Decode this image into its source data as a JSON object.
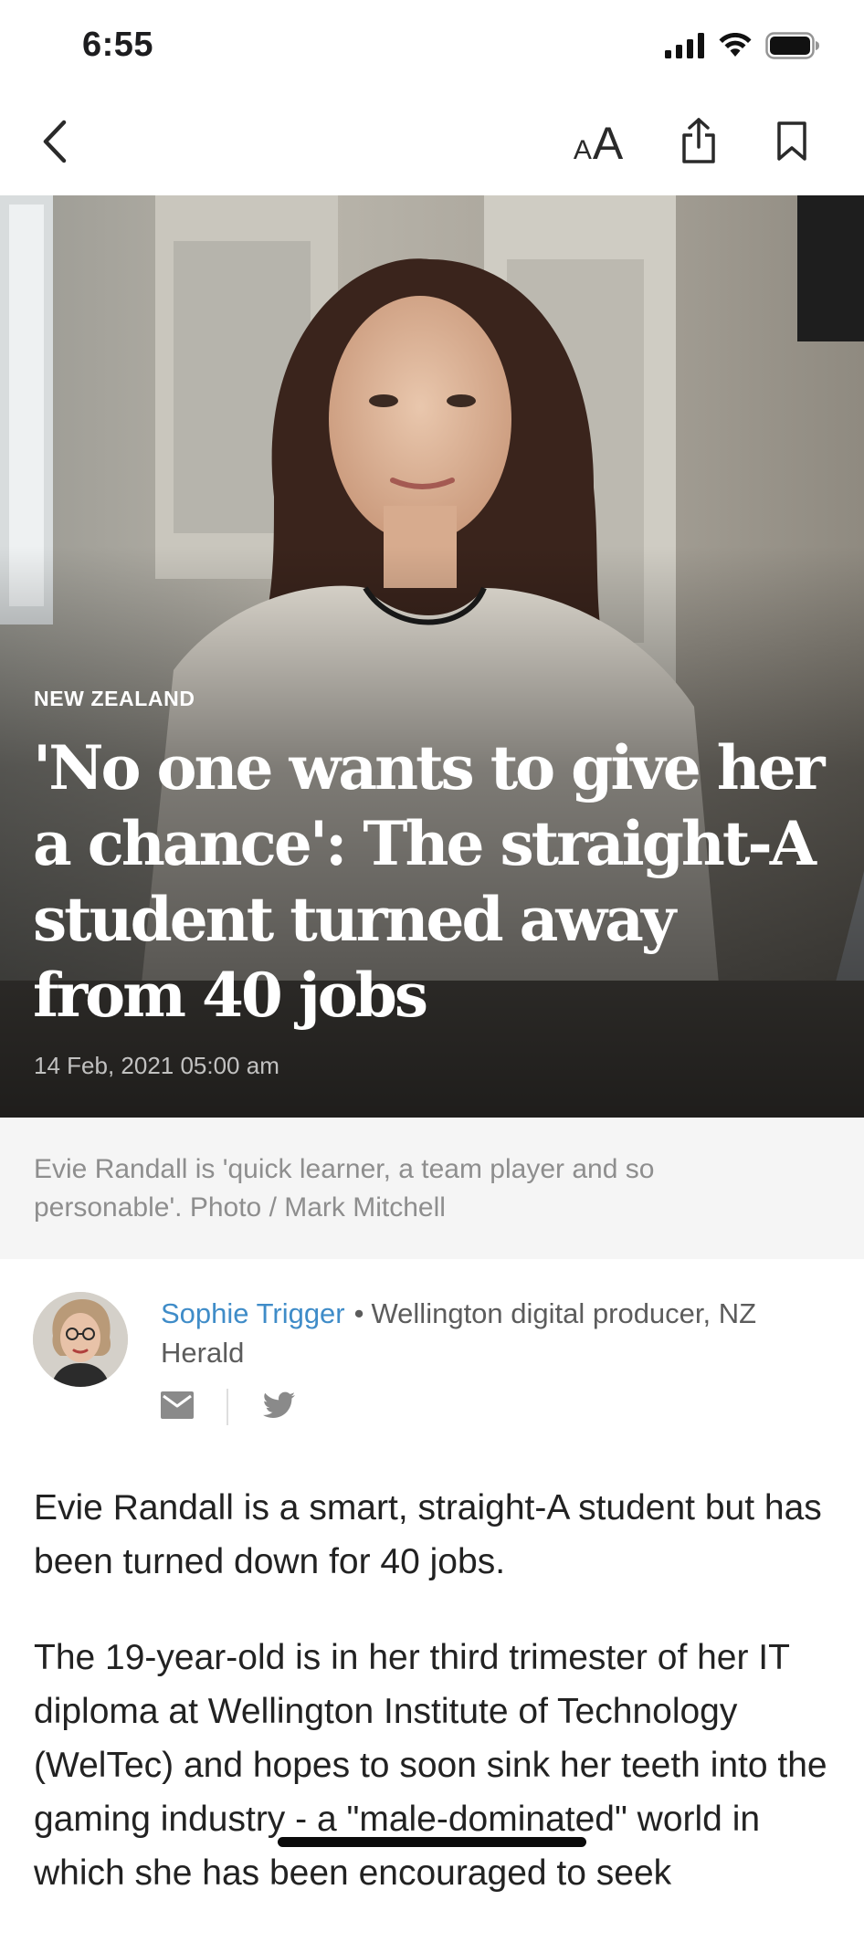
{
  "status_bar": {
    "time": "6:55"
  },
  "nav": {
    "icons": [
      "chevron-left-icon",
      "text-size-icon",
      "share-icon",
      "bookmark-icon"
    ],
    "text_size_small": "A",
    "text_size_large": "A"
  },
  "hero": {
    "section": "NEW ZEALAND",
    "title": "'No one wants to give her a chance': The straight-A student turned away from 40 jobs",
    "date": "14 Feb, 2021 05:00 am"
  },
  "caption": {
    "text": "Evie Randall is 'quick learner, a team player and so personable'. Photo / Mark Mitchell"
  },
  "author": {
    "name": "Sophie Trigger",
    "separator": "•",
    "role": "Wellington digital producer, NZ Herald",
    "icons": [
      "email-icon",
      "twitter-icon"
    ]
  },
  "article": {
    "paragraphs": [
      "Evie Randall is a smart, straight-A student but has been turned down for 40 jobs.",
      "The 19-year-old is in her third trimester of her IT diploma at Wellington Institute of Technology (WelTec) and hopes to soon sink her teeth into the gaming industry - a \"male-dominated\" world in which she has been encouraged to seek"
    ]
  },
  "colors": {
    "accent_link": "#3f8cc8",
    "caption_bg": "#f5f5f5",
    "caption_text": "#8e8e8e"
  }
}
